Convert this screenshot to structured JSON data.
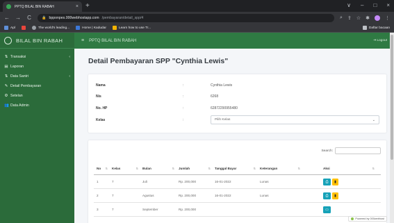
{
  "browser": {
    "tab_title": "PPTQ BILAL BIN RABAH",
    "tab_close": "×",
    "new_tab": "+",
    "window_controls": [
      "∨",
      "–",
      "□",
      "×"
    ],
    "nav": {
      "back": "←",
      "forward": "→",
      "reload": "C"
    },
    "url_host": "bpponpes.000webhostapp.com",
    "url_path": "/pembayaran/detail_spp/4",
    "bookmarks": [
      {
        "label": "Apl",
        "color": "#5f8fd8"
      },
      {
        "label": "",
        "color": "#e8453c"
      },
      {
        "label": "The world's leading...",
        "color": "#9aa0a6"
      },
      {
        "label": "Home | Kadudar",
        "color": "#3c78d8"
      },
      {
        "label": "Learn how to use Tr...",
        "color": "#f4b400"
      }
    ],
    "bookmarks_right": "Daftar bacaan"
  },
  "sidebar": {
    "brand": "BILAL BIN RABAH",
    "items": [
      {
        "icon": "⇅",
        "label": "Transaksi",
        "has_arrow": true
      },
      {
        "icon": "▤",
        "label": "Laporan",
        "has_arrow": false
      },
      {
        "icon": "⇅",
        "label": "Data Santri",
        "has_arrow": true
      },
      {
        "icon": "✎",
        "label": "Detail Pembayaran",
        "has_arrow": false
      },
      {
        "icon": "⚙",
        "label": "Setelan",
        "has_arrow": false
      },
      {
        "icon": "👥",
        "label": "Data Admin",
        "has_arrow": false
      }
    ]
  },
  "topnav": {
    "title": "PPTQ BILAL BIN RABAH",
    "logout": "Logout"
  },
  "page": {
    "title": "Detail Pembayaran SPP \"Cynthia Lewis\""
  },
  "details": {
    "separator": ":",
    "rows": [
      {
        "key": "Nama",
        "value": "Cynthia Lewis"
      },
      {
        "key": "Nis",
        "value": "6268"
      },
      {
        "key": "No. HP",
        "value": "62872290955480"
      },
      {
        "key": "Kelas",
        "value": "Pilih Kelas"
      }
    ]
  },
  "table": {
    "search_label": "Search:",
    "search_value": "",
    "columns": [
      "No",
      "Kelas",
      "Bulan",
      "Jumlah",
      "Tanggal Bayar",
      "Keterangan",
      "Aksi"
    ],
    "rows": [
      {
        "no": "1",
        "kelas": "7",
        "bulan": "Juli",
        "jumlah": "Rp. 200,000",
        "tanggal": "16-01-2022",
        "keterangan": "Lunas"
      },
      {
        "no": "2",
        "kelas": "7",
        "bulan": "Agustus",
        "jumlah": "Rp. 200,000",
        "tanggal": "16-01-2022",
        "keterangan": "Lunas"
      },
      {
        "no": "3",
        "kelas": "7",
        "bulan": "September",
        "jumlah": "Rp. 200,000",
        "tanggal": "",
        "keterangan": ""
      }
    ]
  },
  "footer_badge": "Powered by 000webhost",
  "colors": {
    "sidebar": "#2b6b3a",
    "topnav": "#2f7a43",
    "print_button": "#17a2b8",
    "delete_button": "#ffc107"
  }
}
